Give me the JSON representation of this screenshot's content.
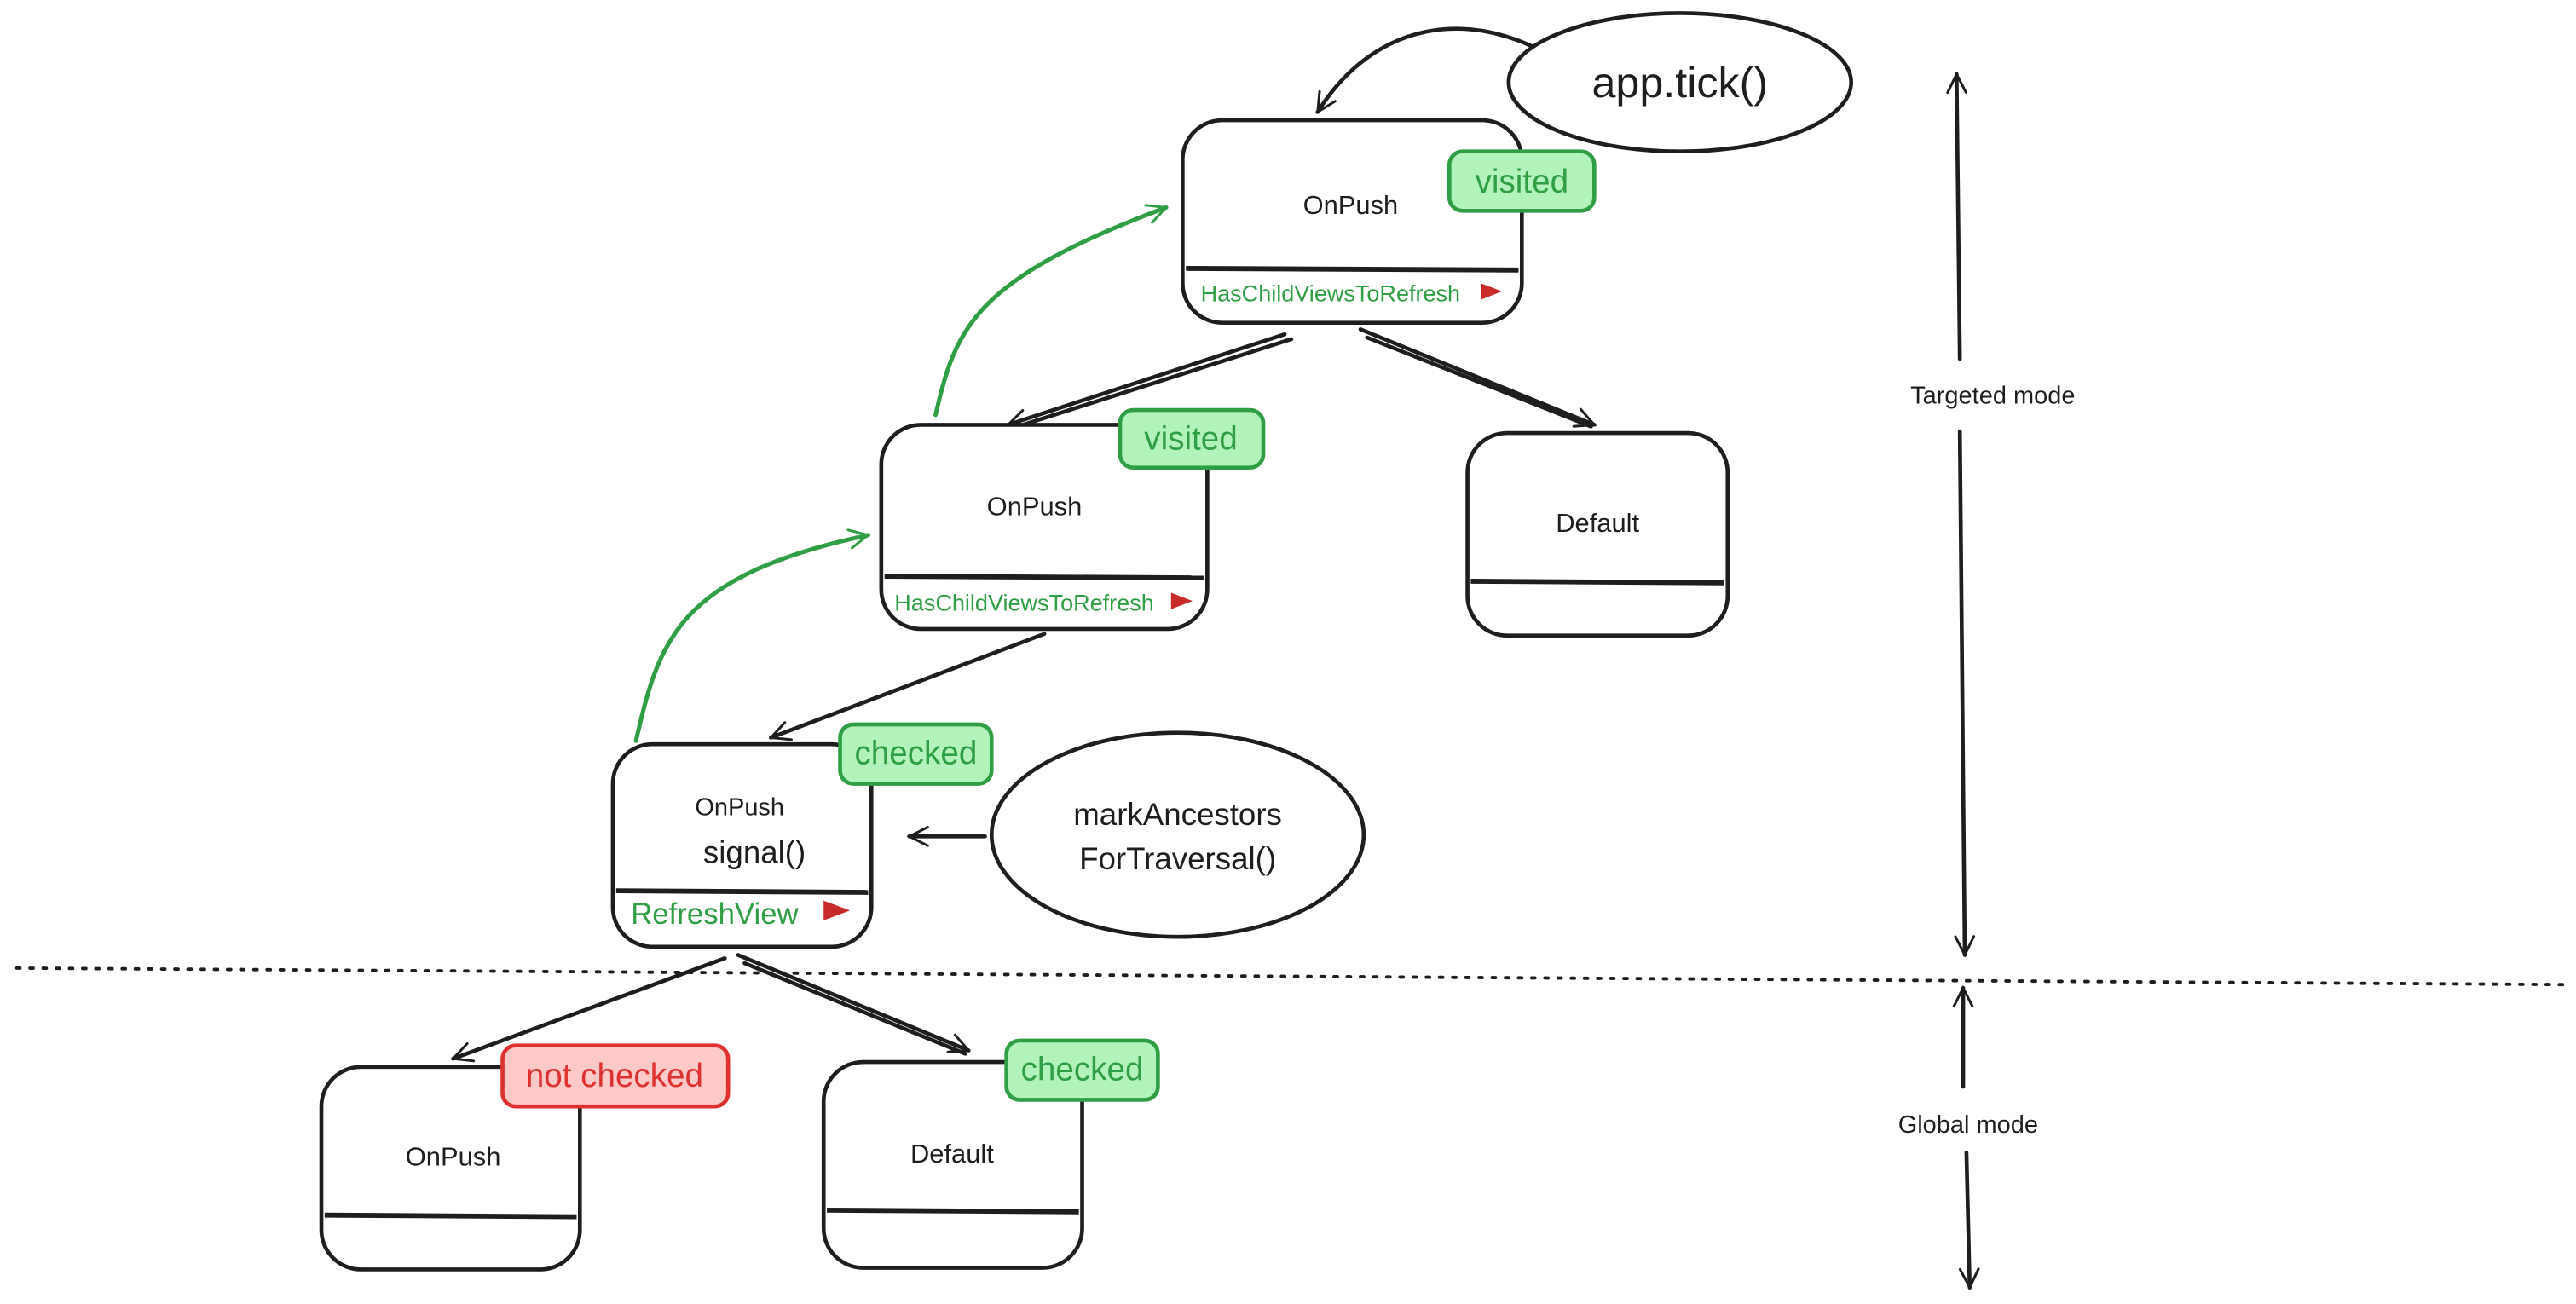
{
  "colors": {
    "stroke": "#1e1e1e",
    "green": "#2f9e44",
    "green_fill": "#b2f2bb",
    "red": "#e03131",
    "red_fill": "#ffc9c9",
    "flag": "#c92a2a"
  },
  "ellipses": {
    "tick": "app.tick()",
    "mark_line1": "markAncestors",
    "mark_line2": "ForTraversal()"
  },
  "nodes": [
    {
      "title": "OnPush",
      "footer": "HasChildViewsToRefresh",
      "footer_icon": "red-flag-icon",
      "badge": "visited",
      "badge_status": "green"
    },
    {
      "title": "OnPush",
      "footer": "HasChildViewsToRefresh",
      "footer_icon": "red-flag-icon",
      "badge": "visited",
      "badge_status": "green"
    },
    {
      "title": "Default",
      "footer": "",
      "badge": "",
      "badge_status": ""
    },
    {
      "title": "OnPush",
      "subtitle": "signal()",
      "footer": "RefreshView",
      "footer_icon": "red-flag-icon",
      "badge": "checked",
      "badge_status": "green"
    },
    {
      "title": "OnPush",
      "footer": "",
      "badge": "not checked",
      "badge_status": "red"
    },
    {
      "title": "Default",
      "footer": "",
      "badge": "checked",
      "badge_status": "green"
    }
  ],
  "modes": {
    "targeted": "Targeted mode",
    "global": "Global mode"
  }
}
